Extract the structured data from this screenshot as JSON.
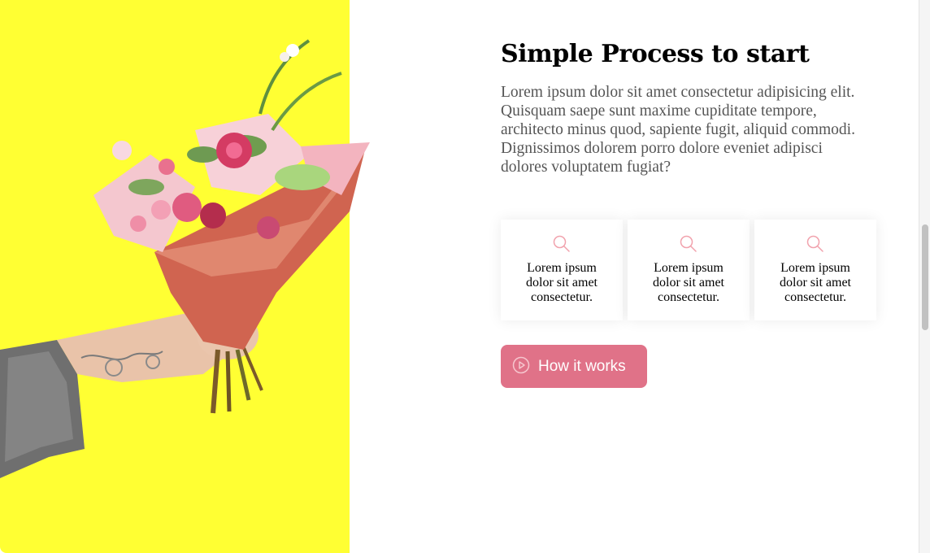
{
  "process_section": {
    "heading": "Simple Process to start",
    "description": "Lorem ipsum dolor sit amet consectetur adipisicing elit. Quisquam saepe sunt maxime cupiditate tempore, architecto minus quod, sapiente fugit, aliquid commodi. Dignissimos dolorem porro dolore eveniet adipisci dolores voluptatem fugiat?",
    "hero_background_color": "#ffff33",
    "feature_cards": [
      {
        "icon": "search-icon",
        "text": "Lorem ipsum dolor sit amet consectetur."
      },
      {
        "icon": "search-icon",
        "text": "Lorem ipsum dolor sit amet consectetur."
      },
      {
        "icon": "search-icon",
        "text": "Lorem ipsum dolor sit amet consectetur."
      }
    ],
    "cta": {
      "icon": "play-circle-icon",
      "label": "How it works",
      "color": "#e07288"
    }
  }
}
